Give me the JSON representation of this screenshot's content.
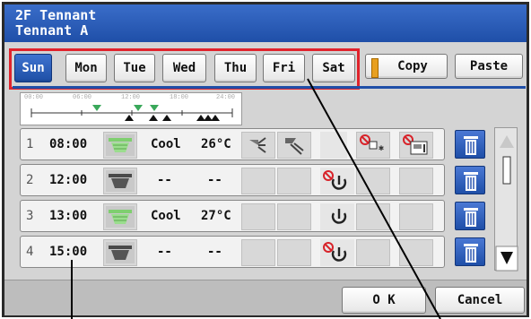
{
  "window": {
    "title_line1": "2F Tennant",
    "title_line2": "Tennant A"
  },
  "days": [
    "Sun",
    "Mon",
    "Tue",
    "Wed",
    "Thu",
    "Fri",
    "Sat"
  ],
  "selected_day": "Sun",
  "actions": {
    "copy": "Copy",
    "paste": "Paste",
    "ok": "O K",
    "cancel": "Cancel"
  },
  "timeline": {
    "ticks": [
      "00:00",
      "06:00",
      "12:00",
      "18:00",
      "24:00"
    ]
  },
  "rows": [
    {
      "num": "1",
      "time": "08:00",
      "mode": "Cool",
      "temp": "26°C",
      "unit_on": true
    },
    {
      "num": "2",
      "time": "12:00",
      "mode": "--",
      "temp": "--",
      "unit_on": false
    },
    {
      "num": "3",
      "time": "13:00",
      "mode": "Cool",
      "temp": "27°C",
      "unit_on": true
    },
    {
      "num": "4",
      "time": "15:00",
      "mode": "--",
      "temp": "--",
      "unit_on": false
    }
  ],
  "colors": {
    "accent": "#1f4fa8",
    "highlight_box": "#e0232c",
    "unit_on": "#7fcf6f",
    "unit_off": "#4a4a4a",
    "prohibit": "#d8232a"
  }
}
